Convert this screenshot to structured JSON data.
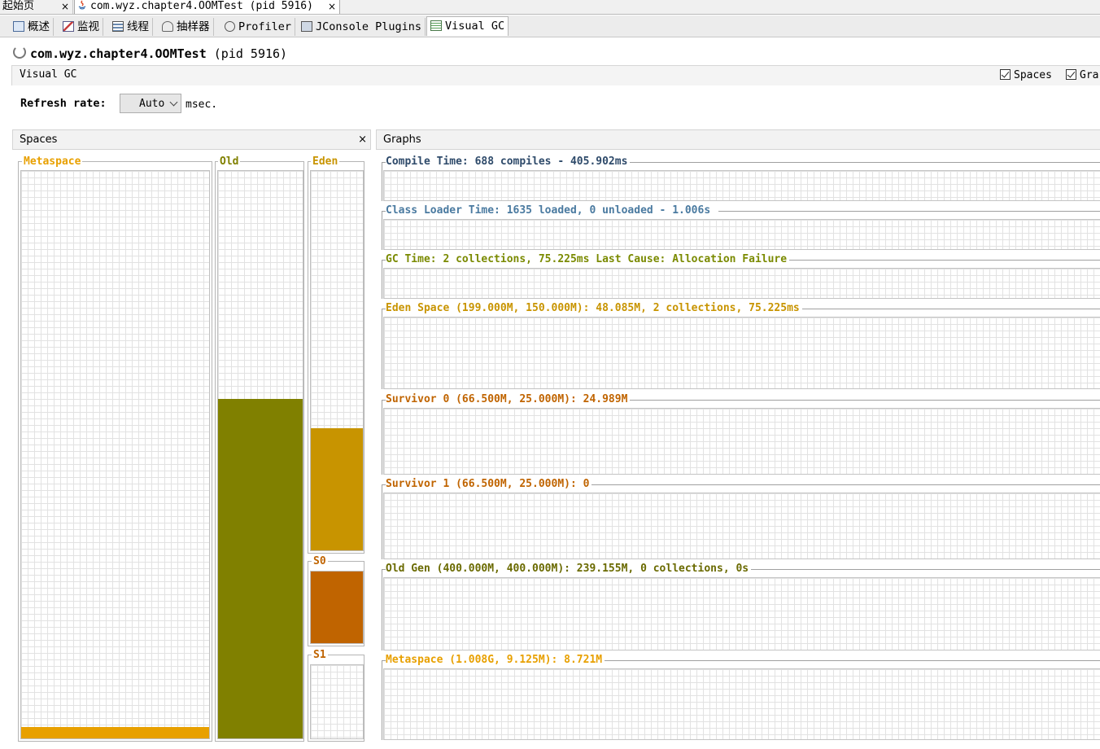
{
  "document_tabs": [
    {
      "label": "起始页",
      "close": "×"
    },
    {
      "label": "com.wyz.chapter4.OOMTest (pid 5916)",
      "close": "×"
    }
  ],
  "view_tabs": [
    {
      "label": "概述",
      "icon": "overview-icon"
    },
    {
      "label": "监视",
      "icon": "monitor-icon"
    },
    {
      "label": "线程",
      "icon": "threads-icon"
    },
    {
      "label": "抽样器",
      "icon": "sampler-icon"
    },
    {
      "label": "Profiler",
      "icon": "profiler-icon"
    },
    {
      "label": "JConsole Plugins",
      "icon": "jconsole-icon"
    },
    {
      "label": "Visual GC",
      "icon": "visual-gc-icon"
    }
  ],
  "app": {
    "name": "com.wyz.chapter4.OOMTest",
    "pid": "(pid 5916)"
  },
  "vgc_bar": {
    "label": "Visual GC",
    "checkbox_spaces": "Spaces",
    "checkbox_graphs": "Gra"
  },
  "refresh": {
    "label": "Refresh rate:",
    "value": "Auto",
    "unit": "msec."
  },
  "spaces_panel": {
    "title": "Spaces",
    "close": "×",
    "metaspace": {
      "label": "Metaspace",
      "fill": 0.02,
      "color": "#e8a000"
    },
    "old": {
      "label": "Old",
      "fill": 0.598,
      "color": "#808000"
    },
    "eden": {
      "label": "Eden",
      "fill": 0.322,
      "color": "#c89400"
    },
    "s0": {
      "label": "S0",
      "fill": 1.0,
      "color": "#c06400"
    },
    "s1": {
      "label": "S1",
      "fill": 0.0,
      "color": "#c06400"
    }
  },
  "graphs_panel": {
    "title": "Graphs",
    "compile": {
      "label": "Compile Time: 688 compiles - 405.902ms",
      "color": "#2e4a6a"
    },
    "classloader": {
      "label": "Class Loader Time: 1635 loaded, 0 unloaded - 1.006s",
      "color": "#4a7aa0"
    },
    "gc": {
      "label": "GC Time: 2 collections, 75.225ms Last Cause: Allocation Failure",
      "color": "#7a8a00"
    },
    "eden": {
      "label": "Eden Space (199.000M, 150.000M): 48.085M, 2 collections, 75.225ms",
      "color": "#c89400"
    },
    "survivor0": {
      "label": "Survivor 0 (66.500M, 25.000M): 24.989M",
      "color": "#c06400"
    },
    "survivor1": {
      "label": "Survivor 1 (66.500M, 25.000M): 0",
      "color": "#c06400"
    },
    "oldgen": {
      "label": "Old Gen (400.000M, 400.000M): 239.155M, 0 collections, 0s",
      "color": "#6a6a00"
    },
    "metaspace": {
      "label": "Metaspace (1.008G, 9.125M): 8.721M",
      "color": "#e8a000"
    }
  }
}
